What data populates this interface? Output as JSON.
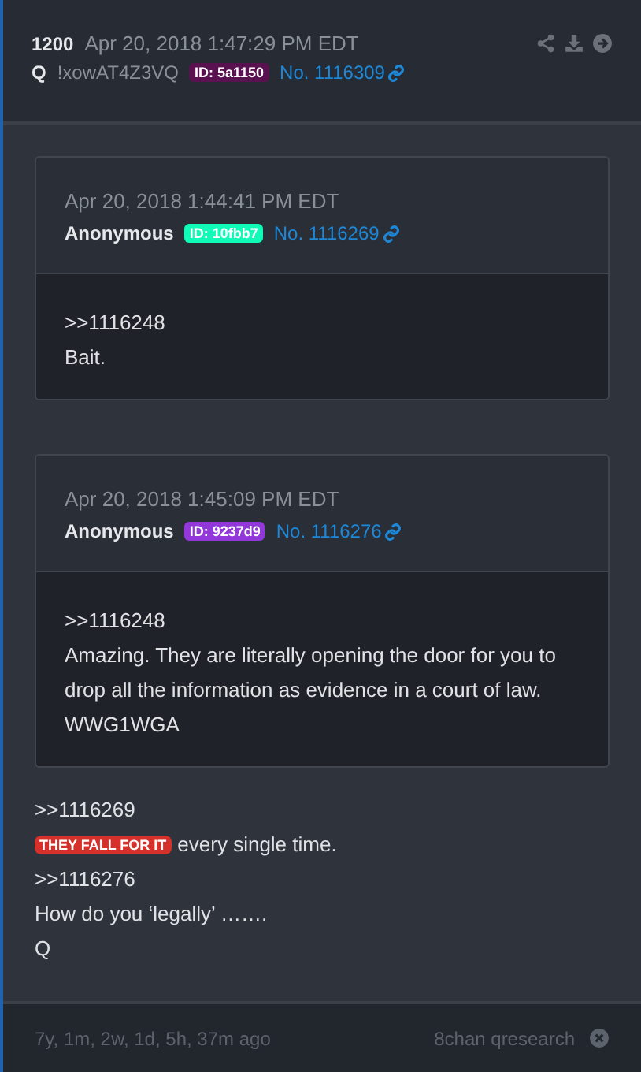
{
  "post": {
    "number": "1200",
    "date": "Apr 20, 2018 1:47:29 PM EDT",
    "author": "Q",
    "tripcode": "!xowAT4Z3VQ",
    "id_badge": {
      "text": "ID: 5a1150",
      "color": "#5a1150"
    },
    "post_link": "No. 1116309"
  },
  "quotes": [
    {
      "date": "Apr 20, 2018 1:44:41 PM EDT",
      "author": "Anonymous",
      "id_badge": {
        "text": "ID: 10fbb7",
        "color": "#10fbb7"
      },
      "post_link": "No. 1116269",
      "lines": [
        ">>1116248",
        "Bait."
      ]
    },
    {
      "date": "Apr 20, 2018 1:45:09 PM EDT",
      "author": "Anonymous",
      "id_badge": {
        "text": "ID: 9237d9",
        "color": "#9237d9"
      },
      "post_link": "No. 1116276",
      "lines": [
        ">>1116248",
        "Amazing. They are literally opening the door for you to drop all the information as evidence in a court of law.",
        "WWG1WGA"
      ]
    }
  ],
  "body": [
    {
      "kind": "text",
      "text": ">>1116269"
    },
    {
      "kind": "tagged",
      "tag": "THEY FALL FOR IT",
      "text": "every single time."
    },
    {
      "kind": "text",
      "text": ">>1116276"
    },
    {
      "kind": "text",
      "text": "How do you ‘legally’ ……."
    },
    {
      "kind": "text",
      "text": "Q"
    }
  ],
  "footer": {
    "age": "7y, 1m, 2w, 1d, 5h, 37m ago",
    "source": "8chan qresearch"
  }
}
